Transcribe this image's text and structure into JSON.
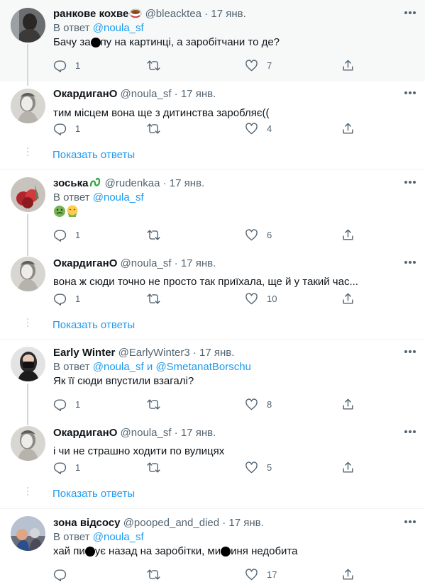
{
  "threads": [
    {
      "author": {
        "name": "ранкове кохве",
        "handle": "@bleacktea",
        "date": "17 янв.",
        "emoji": "coffee-cup-emoji"
      },
      "reply_label": "В ответ",
      "reply_to": "@noula_sf",
      "text_before": "Бачу за",
      "text_after": "пу на картинці, а заробітчани то де?",
      "replies": "1",
      "retweets": "",
      "likes": "7"
    },
    {
      "author": {
        "name": "ОкардиганО",
        "handle": "@noula_sf",
        "date": "17 янв."
      },
      "text": "тим місцем вона ще з дитинства заробляє((",
      "replies": "1",
      "retweets": "",
      "likes": "4",
      "show_replies": "Показать ответы"
    },
    {
      "author": {
        "name": "зоська",
        "handle": "@rudenkaa",
        "date": "17 янв.",
        "emoji": "snake-emoji"
      },
      "reply_label": "В ответ",
      "reply_to": "@noula_sf",
      "emojis": [
        "nauseated-face-emoji",
        "vomiting-face-emoji"
      ],
      "replies": "1",
      "retweets": "",
      "likes": "6"
    },
    {
      "author": {
        "name": "ОкардиганО",
        "handle": "@noula_sf",
        "date": "17 янв."
      },
      "text": "вона ж сюди точно не просто так приїхала, ще й у такий час...",
      "replies": "1",
      "retweets": "",
      "likes": "10",
      "show_replies": "Показать ответы"
    },
    {
      "author": {
        "name": "Early Winter",
        "handle": "@EarlyWinter3",
        "date": "17 янв."
      },
      "reply_label": "В ответ",
      "reply_to": "@noula_sf",
      "reply_and": "и",
      "reply_to_2": "@SmetanatBorschu",
      "text": "Як її сюди впустили взагалі?",
      "replies": "1",
      "retweets": "",
      "likes": "8"
    },
    {
      "author": {
        "name": "ОкардиганО",
        "handle": "@noula_sf",
        "date": "17 янв."
      },
      "text": "і чи не страшно ходити по вулицях",
      "replies": "1",
      "retweets": "",
      "likes": "5",
      "show_replies": "Показать ответы"
    },
    {
      "author": {
        "name": "зона відсосу",
        "handle": "@pooped_and_died",
        "date": "17 янв."
      },
      "reply_label": "В ответ",
      "reply_to": "@noula_sf",
      "text_a": "хай пи",
      "text_b": "ує назад на заробітки, ми",
      "text_c": "иня недобита",
      "replies": "",
      "retweets": "",
      "likes": "17"
    }
  ],
  "dot_separator": "·",
  "colors": {
    "link": "#1d9bf0",
    "muted": "#536471",
    "highlight_bg": "#f7f9f9"
  }
}
